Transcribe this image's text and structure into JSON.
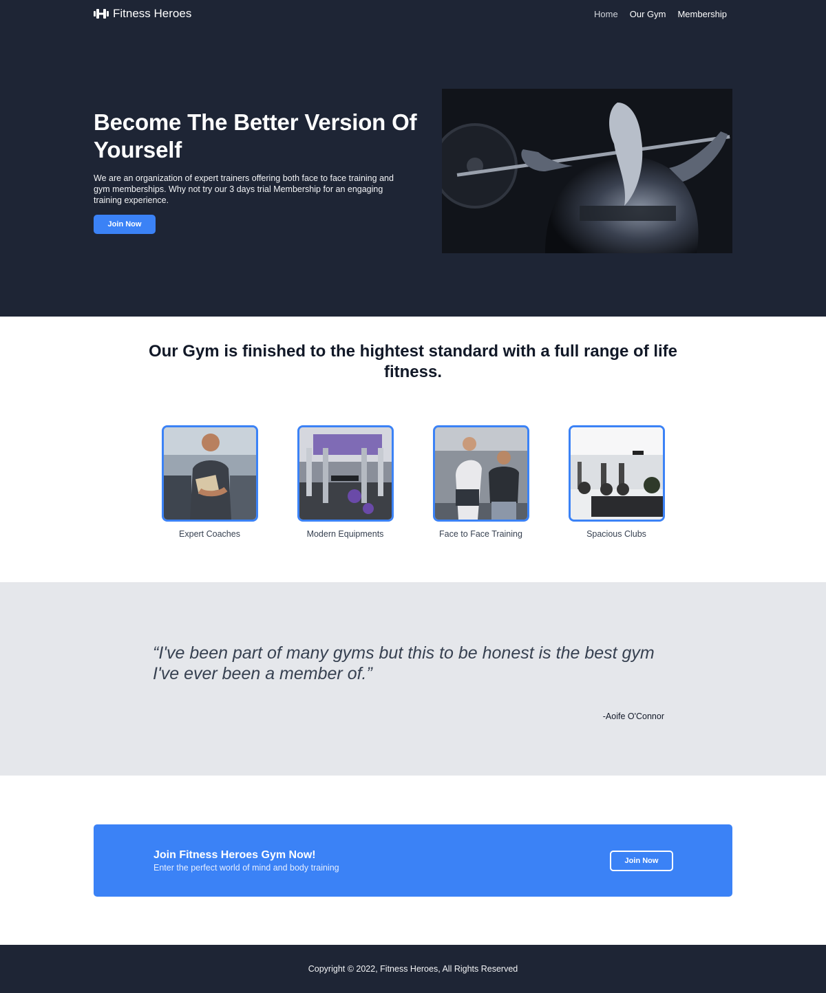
{
  "nav": {
    "brand": "Fitness Heroes",
    "logo_icon": "dumbbell-icon",
    "links": [
      "Home",
      "Our Gym",
      "Membership"
    ]
  },
  "hero": {
    "title": "Become The Better Version Of Yourself",
    "subtitle": "We are an organization of expert trainers offering both face to face training and gym memberships. Why not try our 3 days trial Membership for an engaging training experience.",
    "cta_label": "Join Now"
  },
  "features": {
    "title": "Our Gym is finished to the hightest standard with a full range of life fitness.",
    "items": [
      {
        "label": "Expert Coaches"
      },
      {
        "label": "Modern Equipments"
      },
      {
        "label": "Face to Face Training"
      },
      {
        "label": "Spacious Clubs"
      }
    ]
  },
  "testimonial": {
    "quote": "“I've been part of many gyms but this to be honest is the best gym I've ever been a member of.”",
    "author": "-Aoife O'Connor"
  },
  "cta": {
    "title": "Join Fitness Heroes Gym Now!",
    "subtitle": "Enter the perfect world of mind and body training",
    "button_label": "Join Now"
  },
  "footer": {
    "copyright": "Copyright © 2022, Fitness Heroes, All Rights Reserved"
  },
  "colors": {
    "dark_bg": "#1e2535",
    "accent": "#3b82f6",
    "light_gray": "#e5e7eb"
  }
}
